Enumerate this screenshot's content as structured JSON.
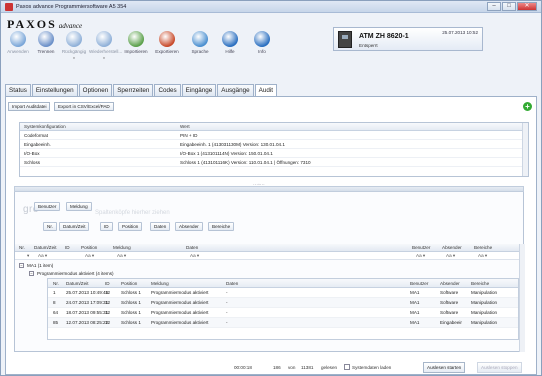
{
  "window": {
    "title": "Paxos advance Programmiersoftware A5 354"
  },
  "brand": {
    "name": "PAXOS",
    "suffix": "advance"
  },
  "ribbon": [
    {
      "label": "Anwenden",
      "icon": "apply-icon",
      "color": "#7aa6d8",
      "enabled": false
    },
    {
      "label": "Trennen",
      "icon": "disconnect-icon",
      "color": "#6a8fc8",
      "enabled": true
    },
    {
      "label": "Rückgängig",
      "icon": "undo-icon",
      "color": "#8fb0d8",
      "enabled": false
    },
    {
      "label": "Wiederherstell...",
      "icon": "redo-icon",
      "color": "#8fb0d8",
      "enabled": false
    },
    {
      "label": "Importieren",
      "icon": "import-icon",
      "color": "#5aa04a",
      "enabled": true
    },
    {
      "label": "Exportieren",
      "icon": "export-icon",
      "color": "#c84a2a",
      "enabled": true
    },
    {
      "label": "Sprache",
      "icon": "language-icon",
      "color": "#4a8fd0",
      "enabled": true
    },
    {
      "label": "Hilfe",
      "icon": "help-icon",
      "color": "#2a6fc0",
      "enabled": true
    },
    {
      "label": "Info",
      "icon": "info-icon",
      "color": "#2a6fc0",
      "enabled": true
    }
  ],
  "device": {
    "name": "ATM ZH 8620-1",
    "status": "Entsperrt",
    "timestamp": "25.07.2013 10:52"
  },
  "tabs": [
    "Status",
    "Einstellungen",
    "Optionen",
    "Sperrzeiten",
    "Codes",
    "Eingänge",
    "Ausgänge",
    "Audit"
  ],
  "active_tab": "Audit",
  "actions": {
    "import": "Import Auditdatei",
    "export": "Export in CSV/Excel/PAD"
  },
  "config": {
    "headers": [
      "Systemkonfiguration",
      "Wert"
    ],
    "rows": [
      [
        "Codeformat",
        "PIN + ID"
      ],
      [
        "Eingabeeinh.",
        "Eingabeeinh. 1 (413031130M) Version: 130.01.04.1"
      ],
      [
        "I/O-Box",
        "I/O-Box 1 (413101114N) Version: 150.01.04.1"
      ],
      [
        "Schloss",
        "Schloss 1 (413101116K) Version: 110.01.04.1 | Öffnungen: 7310"
      ]
    ]
  },
  "grouping": {
    "watermark": "gro",
    "hint": "Spaltenköpfe hierher ziehen",
    "group_chips": [
      "Benutzer",
      "Meldung"
    ],
    "column_chips": [
      "Nr.",
      "Datum/Zeit",
      "ID",
      "Position",
      "Daten",
      "Absender",
      "Bereiche"
    ]
  },
  "grid": {
    "headers": [
      "Nr.",
      "Datum/Zeit",
      "ID",
      "Position",
      "Meldung",
      "Daten",
      "Benutzer",
      "Absender",
      "Bereiche"
    ],
    "filter_ops": [
      "Aa"
    ],
    "group1": "MA1 (1 item)",
    "group2": "Programmiermodus aktiviert (4 items)",
    "inner_headers": [
      "Nr.",
      "Datum/Zeit",
      "ID",
      "Position",
      "Meldung",
      "Daten",
      "Benutzer",
      "Absender",
      "Bereiche"
    ],
    "rows": [
      {
        "nr": "1",
        "date": "25.07.2013 10:49:46",
        "id": "12",
        "pos": "Schloss 1",
        "msg": "Programmiermodus aktiviert",
        "data": "-",
        "user": "MA1",
        "sender": "Software",
        "area": "Manipulation"
      },
      {
        "nr": "8",
        "date": "24.07.2013 17:09:31",
        "id": "12",
        "pos": "Schloss 1",
        "msg": "Programmiermodus aktiviert",
        "data": "-",
        "user": "MA1",
        "sender": "Software",
        "area": "Manipulation"
      },
      {
        "nr": "64",
        "date": "18.07.2013 09:55:31",
        "id": "12",
        "pos": "Schloss 1",
        "msg": "Programmiermodus aktiviert",
        "data": "-",
        "user": "MA1",
        "sender": "Software",
        "area": "Manipulation"
      },
      {
        "nr": "85",
        "date": "12.07.2013 08:25:22",
        "id": "12",
        "pos": "Schloss 1",
        "msg": "Programmiermodus aktiviert",
        "data": "-",
        "user": "MA1",
        "sender": "Eingabeeir",
        "area": "Manipulation"
      }
    ]
  },
  "statusbar": {
    "elapsed": "00:00:18",
    "read": "186",
    "of": "von",
    "total": "11381",
    "read_label": "gelesen",
    "system_label": "Systemdaten laden",
    "start_button": "Auslesen starten",
    "stop_button": "Auslesen stoppen"
  }
}
